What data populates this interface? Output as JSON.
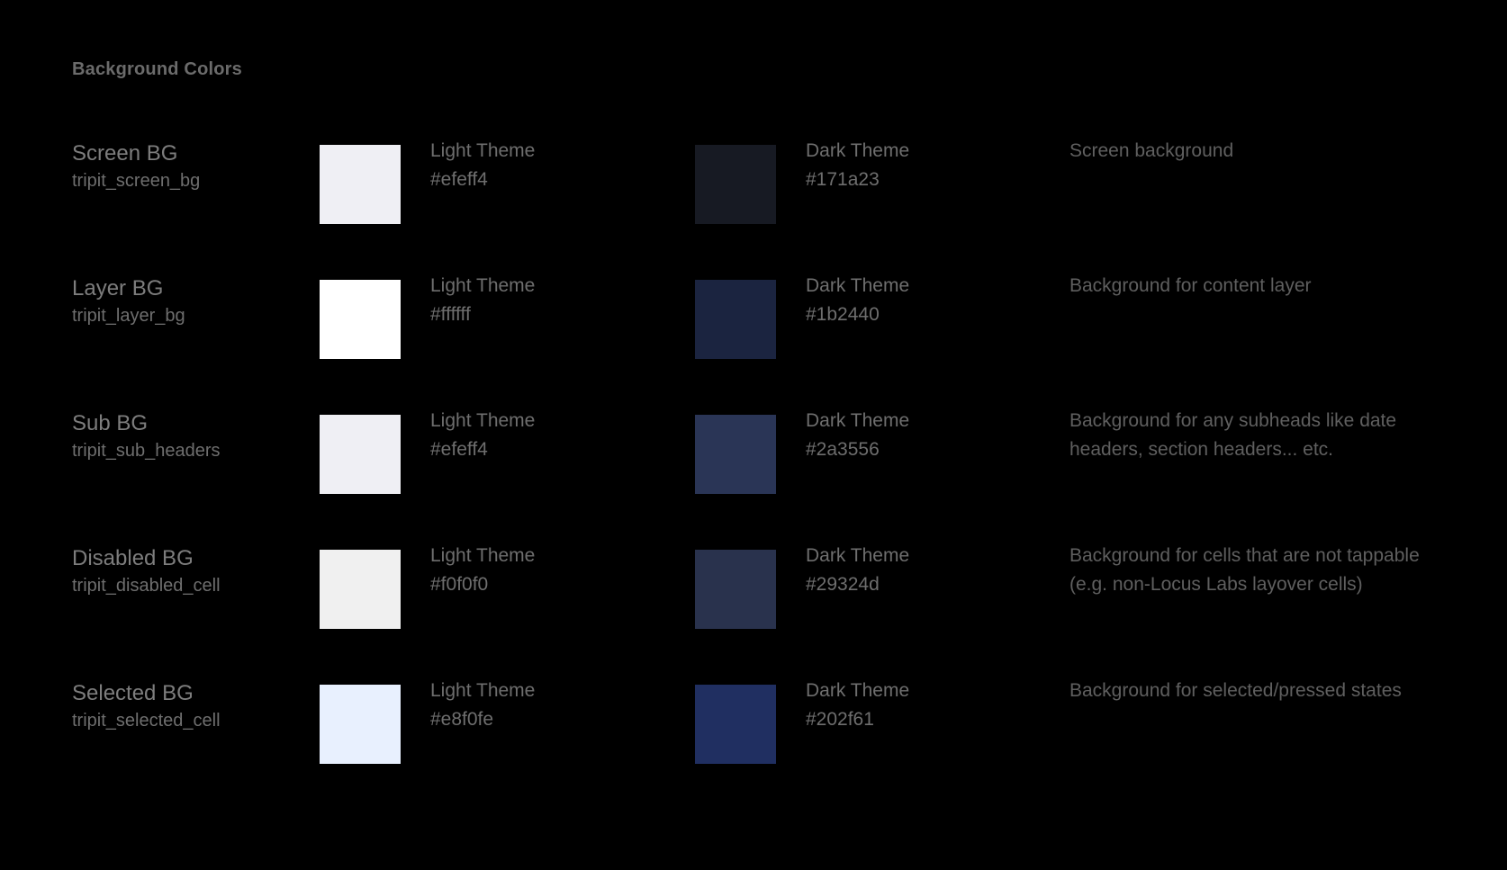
{
  "section": {
    "title": "Background Colors"
  },
  "labels": {
    "light_theme": "Light Theme",
    "dark_theme": "Dark Theme"
  },
  "rows": [
    {
      "name": "Screen BG",
      "token": "tripit_screen_bg",
      "light_label": "Light Theme",
      "light_hex": "#efeff4",
      "dark_label": "Dark Theme",
      "dark_hex": "#171a23",
      "description": "Screen background"
    },
    {
      "name": "Layer BG",
      "token": "tripit_layer_bg",
      "light_label": "Light Theme",
      "light_hex": "#ffffff",
      "dark_label": "Dark Theme",
      "dark_hex": "#1b2440",
      "description": "Background for content layer"
    },
    {
      "name": "Sub BG",
      "token": "tripit_sub_headers",
      "light_label": "Light Theme",
      "light_hex": "#efeff4",
      "dark_label": "Dark Theme",
      "dark_hex": "#2a3556",
      "description": "Background for any subheads like date headers, section headers... etc."
    },
    {
      "name": "Disabled BG",
      "token": "tripit_disabled_cell",
      "light_label": "Light Theme",
      "light_hex": "#f0f0f0",
      "dark_label": "Dark Theme",
      "dark_hex": "#29324d",
      "description": "Background for cells that are not tappable (e.g. non-Locus Labs layover cells)"
    },
    {
      "name": "Selected BG",
      "token": "tripit_selected_cell",
      "light_label": "Light Theme",
      "light_hex": "#e8f0fe",
      "dark_label": "Dark Theme",
      "dark_hex": "#202f61",
      "description": "Background for selected/pressed states"
    }
  ],
  "page_background": "#000000"
}
